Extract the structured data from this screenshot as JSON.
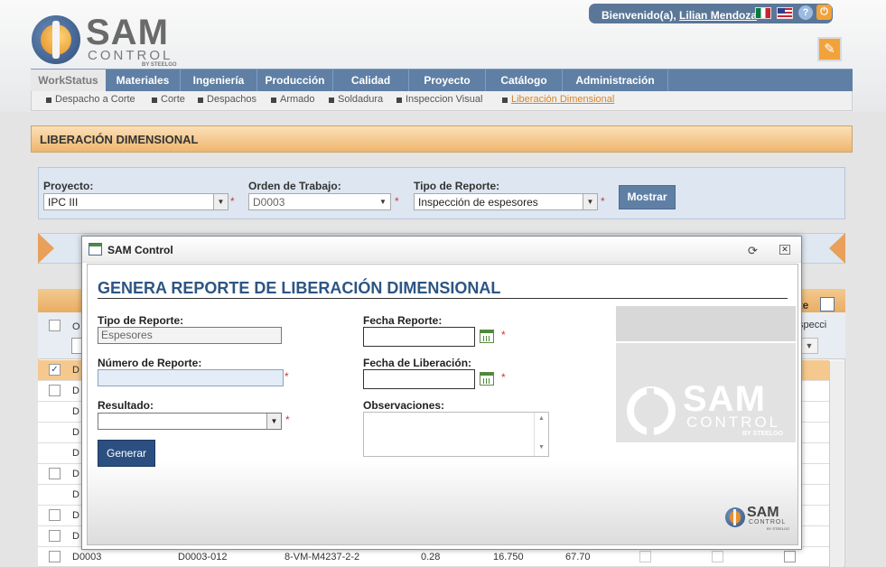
{
  "header": {
    "logo": {
      "line1": "SAM",
      "line2": "CONTROL",
      "line3": "BY STEELGO"
    },
    "welcome_prefix": "Bienvenido(a),",
    "user_name": "Lilian Mendoza"
  },
  "nav": {
    "tabs": [
      "WorkStatus",
      "Materiales",
      "Ingeniería",
      "Producción",
      "Calidad",
      "Proyecto",
      "Catálogo",
      "Administración"
    ],
    "active_tab": "WorkStatus",
    "sub_items": [
      "Despacho a Corte",
      "Corte",
      "Despachos",
      "Armado",
      "Soldadura",
      "Inspeccion Visual",
      "Liberación Dimensional"
    ],
    "current_sub": "Liberación Dimensional"
  },
  "page": {
    "title": "LIBERACIÓN DIMENSIONAL"
  },
  "filters": {
    "proyecto_label": "Proyecto:",
    "proyecto_value": "IPC III",
    "orden_label": "Orden de Trabajo:",
    "orden_value": "D0003",
    "tipo_label": "Tipo de Reporte:",
    "tipo_value": "Inspección de espesores",
    "mostrar_label": "Mostrar",
    "required_mark": "*"
  },
  "grid": {
    "reporte_label": "rte",
    "inspecc_label": "specci",
    "rows": [
      {
        "col1": "D",
        "checked": true,
        "selected": true
      },
      {
        "col1": "D",
        "checked": false
      },
      {
        "col1": "D",
        "nocb": true
      },
      {
        "col1": "D",
        "nocb": true
      },
      {
        "col1": "D",
        "nocb": true
      },
      {
        "col1": "D",
        "checked": false
      },
      {
        "col1": "D",
        "nocb": true
      },
      {
        "col1": "D",
        "checked": false
      },
      {
        "col1": "D",
        "checked": false
      }
    ],
    "last_row": {
      "orden": "D0003",
      "spool": "D0003-012",
      "iso": "8-VM-M4237-2-2",
      "v1": "0.28",
      "v2": "16.750",
      "v3": "67.70"
    }
  },
  "modal": {
    "title": "SAM Control",
    "heading": "GENERA REPORTE DE LIBERACIÓN DIMENSIONAL",
    "tipo_reporte_label": "Tipo de Reporte:",
    "tipo_reporte_value": "Espesores",
    "numero_reporte_label": "Número de Reporte:",
    "numero_reporte_value": "",
    "resultado_label": "Resultado:",
    "resultado_value": "",
    "fecha_reporte_label": "Fecha Reporte:",
    "fecha_reporte_value": "",
    "fecha_liberacion_label": "Fecha de Liberación:",
    "fecha_liberacion_value": "",
    "observaciones_label": "Observaciones:",
    "observaciones_value": "",
    "generar_label": "Generar",
    "required_mark": "*",
    "watermark": {
      "line1": "SAM",
      "line2": "CONTROL",
      "line3": "BY STEELGO"
    },
    "footer_logo": {
      "line1": "SAM",
      "line2": "CONTROL",
      "line3": "BY STEELGO"
    }
  },
  "colors": {
    "nav_blue": "#5f7fa5",
    "orange_accent": "#eeb66e",
    "heading_blue": "#2d5584",
    "required_red": "#c83a3a"
  },
  "icons": [
    "flag-mexico-icon",
    "flag-usa-icon",
    "help-icon",
    "power-icon",
    "edit-icon",
    "calendar-icon",
    "refresh-icon",
    "close-icon",
    "window-icon"
  ]
}
